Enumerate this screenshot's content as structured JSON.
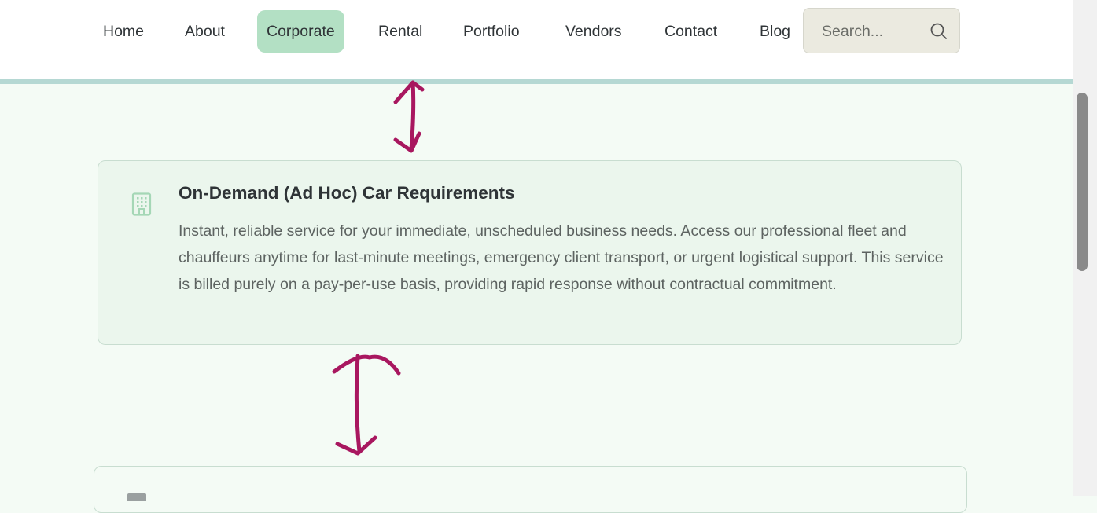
{
  "nav": {
    "items": [
      {
        "label": "Home"
      },
      {
        "label": "About"
      },
      {
        "label": "Corporate",
        "active": true
      },
      {
        "label": "Rental"
      },
      {
        "label": "Portfolio"
      },
      {
        "label": "Vendors"
      },
      {
        "label": "Contact"
      },
      {
        "label": "Blog"
      }
    ],
    "active_color": "#b3e0c4"
  },
  "search": {
    "placeholder": "Search...",
    "value": "",
    "icon": "search-icon"
  },
  "card": {
    "icon": "building-icon",
    "title": "On-Demand (Ad Hoc) Car Requirements",
    "description": "Instant, reliable service for your immediate, unscheduled business needs. Access our professional fleet and chauffeurs anytime for last-minute meetings, emergency client transport, or urgent logistical support. This service is billed purely on a pay-per-use basis, providing rapid response without contractual commitment."
  },
  "annotations": {
    "color": "#a8175f"
  },
  "colors": {
    "page_bg": "#f4fbf5",
    "card_bg": "#ebf6ed",
    "header_line": "#b5d8d3"
  }
}
